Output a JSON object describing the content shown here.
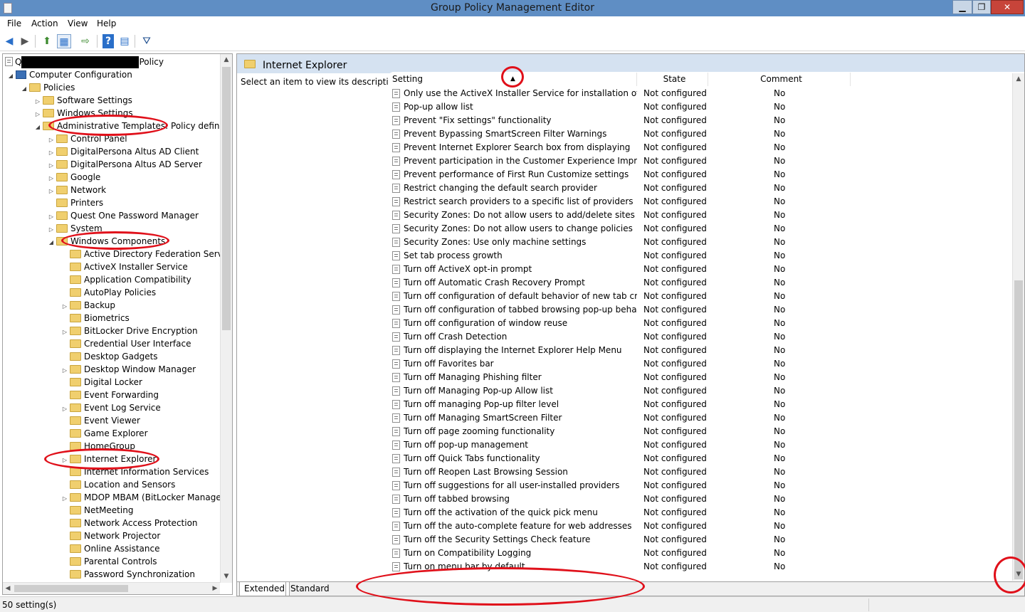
{
  "window": {
    "title": "Group Policy Management Editor"
  },
  "menu": [
    "File",
    "Action",
    "View",
    "Help"
  ],
  "tree": {
    "root_visible": "Q",
    "root_suffix": "Policy",
    "items": [
      {
        "label": "Computer Configuration",
        "level": 1,
        "arrow": "expanded",
        "icon": "computer-icon"
      },
      {
        "label": "Policies",
        "level": 2,
        "arrow": "expanded",
        "icon": "folder-icon"
      },
      {
        "label": "Software Settings",
        "level": 3,
        "arrow": "collapsed",
        "icon": "folder-icon"
      },
      {
        "label": "Windows Settings",
        "level": 3,
        "arrow": "collapsed",
        "icon": "folder-icon"
      },
      {
        "label": "Administrative Templates: Policy definition",
        "level": 3,
        "arrow": "expanded",
        "icon": "folder-icon"
      },
      {
        "label": "Control Panel",
        "level": 4,
        "arrow": "collapsed",
        "icon": "folder-icon"
      },
      {
        "label": "DigitalPersona Altus AD Client",
        "level": 4,
        "arrow": "collapsed",
        "icon": "folder-icon"
      },
      {
        "label": "DigitalPersona Altus AD Server",
        "level": 4,
        "arrow": "collapsed",
        "icon": "folder-icon"
      },
      {
        "label": "Google",
        "level": 4,
        "arrow": "collapsed",
        "icon": "folder-icon"
      },
      {
        "label": "Network",
        "level": 4,
        "arrow": "collapsed",
        "icon": "folder-icon"
      },
      {
        "label": "Printers",
        "level": 4,
        "arrow": "none",
        "icon": "folder-icon"
      },
      {
        "label": "Quest One Password Manager",
        "level": 4,
        "arrow": "collapsed",
        "icon": "folder-icon"
      },
      {
        "label": "System",
        "level": 4,
        "arrow": "collapsed",
        "icon": "folder-icon"
      },
      {
        "label": "Windows Components",
        "level": 4,
        "arrow": "expanded",
        "icon": "folder-icon"
      },
      {
        "label": "Active Directory Federation Services",
        "level": 5,
        "arrow": "none",
        "icon": "folder-icon"
      },
      {
        "label": "ActiveX Installer Service",
        "level": 5,
        "arrow": "none",
        "icon": "folder-icon"
      },
      {
        "label": "Application Compatibility",
        "level": 5,
        "arrow": "none",
        "icon": "folder-icon"
      },
      {
        "label": "AutoPlay Policies",
        "level": 5,
        "arrow": "none",
        "icon": "folder-icon"
      },
      {
        "label": "Backup",
        "level": 5,
        "arrow": "collapsed",
        "icon": "folder-icon"
      },
      {
        "label": "Biometrics",
        "level": 5,
        "arrow": "none",
        "icon": "folder-icon"
      },
      {
        "label": "BitLocker Drive Encryption",
        "level": 5,
        "arrow": "collapsed",
        "icon": "folder-icon"
      },
      {
        "label": "Credential User Interface",
        "level": 5,
        "arrow": "none",
        "icon": "folder-icon"
      },
      {
        "label": "Desktop Gadgets",
        "level": 5,
        "arrow": "none",
        "icon": "folder-icon"
      },
      {
        "label": "Desktop Window Manager",
        "level": 5,
        "arrow": "collapsed",
        "icon": "folder-icon"
      },
      {
        "label": "Digital Locker",
        "level": 5,
        "arrow": "none",
        "icon": "folder-icon"
      },
      {
        "label": "Event Forwarding",
        "level": 5,
        "arrow": "none",
        "icon": "folder-icon"
      },
      {
        "label": "Event Log Service",
        "level": 5,
        "arrow": "collapsed",
        "icon": "folder-icon"
      },
      {
        "label": "Event Viewer",
        "level": 5,
        "arrow": "none",
        "icon": "folder-icon"
      },
      {
        "label": "Game Explorer",
        "level": 5,
        "arrow": "none",
        "icon": "folder-icon"
      },
      {
        "label": "HomeGroup",
        "level": 5,
        "arrow": "none",
        "icon": "folder-icon"
      },
      {
        "label": "Internet Explorer",
        "level": 5,
        "arrow": "collapsed",
        "icon": "folder-icon",
        "selected": true
      },
      {
        "label": "Internet Information Services",
        "level": 5,
        "arrow": "none",
        "icon": "folder-icon"
      },
      {
        "label": "Location and Sensors",
        "level": 5,
        "arrow": "none",
        "icon": "folder-icon"
      },
      {
        "label": "MDOP MBAM (BitLocker Managem",
        "level": 5,
        "arrow": "collapsed",
        "icon": "folder-icon"
      },
      {
        "label": "NetMeeting",
        "level": 5,
        "arrow": "none",
        "icon": "folder-icon"
      },
      {
        "label": "Network Access Protection",
        "level": 5,
        "arrow": "none",
        "icon": "folder-icon"
      },
      {
        "label": "Network Projector",
        "level": 5,
        "arrow": "none",
        "icon": "folder-icon"
      },
      {
        "label": "Online Assistance",
        "level": 5,
        "arrow": "none",
        "icon": "folder-icon"
      },
      {
        "label": "Parental Controls",
        "level": 5,
        "arrow": "none",
        "icon": "folder-icon"
      },
      {
        "label": "Password Synchronization",
        "level": 5,
        "arrow": "none",
        "icon": "folder-icon"
      }
    ]
  },
  "details": {
    "heading": "Internet Explorer",
    "description": "Select an item to view its description.",
    "columns": [
      "Setting",
      "State",
      "Comment"
    ],
    "sort_indicator": "▲",
    "rows": [
      {
        "setting": "Only use the ActiveX Installer Service for installation of Activ...",
        "state": "Not configured",
        "comment": "No"
      },
      {
        "setting": "Pop-up allow list",
        "state": "Not configured",
        "comment": "No"
      },
      {
        "setting": "Prevent \"Fix settings\" functionality",
        "state": "Not configured",
        "comment": "No"
      },
      {
        "setting": "Prevent Bypassing SmartScreen Filter Warnings",
        "state": "Not configured",
        "comment": "No"
      },
      {
        "setting": "Prevent Internet Explorer Search box from displaying",
        "state": "Not configured",
        "comment": "No"
      },
      {
        "setting": "Prevent participation in the Customer Experience Improvem...",
        "state": "Not configured",
        "comment": "No"
      },
      {
        "setting": "Prevent performance of First Run Customize settings",
        "state": "Not configured",
        "comment": "No"
      },
      {
        "setting": "Restrict changing the default search provider",
        "state": "Not configured",
        "comment": "No"
      },
      {
        "setting": "Restrict search providers to a specific list of providers",
        "state": "Not configured",
        "comment": "No"
      },
      {
        "setting": "Security Zones: Do not allow users to add/delete sites",
        "state": "Not configured",
        "comment": "No"
      },
      {
        "setting": "Security Zones: Do not allow users to change policies",
        "state": "Not configured",
        "comment": "No"
      },
      {
        "setting": "Security Zones: Use only machine settings",
        "state": "Not configured",
        "comment": "No"
      },
      {
        "setting": "Set tab process growth",
        "state": "Not configured",
        "comment": "No"
      },
      {
        "setting": "Turn off ActiveX opt-in prompt",
        "state": "Not configured",
        "comment": "No"
      },
      {
        "setting": "Turn off Automatic Crash Recovery Prompt",
        "state": "Not configured",
        "comment": "No"
      },
      {
        "setting": "Turn off configuration of default behavior of new tab creation",
        "state": "Not configured",
        "comment": "No"
      },
      {
        "setting": "Turn off configuration of tabbed browsing pop-up behavior",
        "state": "Not configured",
        "comment": "No"
      },
      {
        "setting": "Turn off configuration of window reuse",
        "state": "Not configured",
        "comment": "No"
      },
      {
        "setting": "Turn off Crash Detection",
        "state": "Not configured",
        "comment": "No"
      },
      {
        "setting": "Turn off displaying the Internet Explorer Help Menu",
        "state": "Not configured",
        "comment": "No"
      },
      {
        "setting": "Turn off Favorites bar",
        "state": "Not configured",
        "comment": "No"
      },
      {
        "setting": "Turn off Managing Phishing filter",
        "state": "Not configured",
        "comment": "No"
      },
      {
        "setting": "Turn off Managing Pop-up Allow list",
        "state": "Not configured",
        "comment": "No"
      },
      {
        "setting": "Turn off managing Pop-up filter level",
        "state": "Not configured",
        "comment": "No"
      },
      {
        "setting": "Turn off Managing SmartScreen Filter",
        "state": "Not configured",
        "comment": "No"
      },
      {
        "setting": "Turn off page zooming functionality",
        "state": "Not configured",
        "comment": "No"
      },
      {
        "setting": "Turn off pop-up management",
        "state": "Not configured",
        "comment": "No"
      },
      {
        "setting": "Turn off Quick Tabs functionality",
        "state": "Not configured",
        "comment": "No"
      },
      {
        "setting": "Turn off Reopen Last Browsing Session",
        "state": "Not configured",
        "comment": "No"
      },
      {
        "setting": "Turn off suggestions for all user-installed providers",
        "state": "Not configured",
        "comment": "No"
      },
      {
        "setting": "Turn off tabbed browsing",
        "state": "Not configured",
        "comment": "No"
      },
      {
        "setting": "Turn off the activation of the quick pick menu",
        "state": "Not configured",
        "comment": "No"
      },
      {
        "setting": "Turn off the auto-complete feature for web addresses",
        "state": "Not configured",
        "comment": "No"
      },
      {
        "setting": "Turn off the Security Settings Check feature",
        "state": "Not configured",
        "comment": "No"
      },
      {
        "setting": "Turn on Compatibility Logging",
        "state": "Not configured",
        "comment": "No"
      },
      {
        "setting": "Turn on menu bar by default",
        "state": "Not configured",
        "comment": "No"
      }
    ]
  },
  "tabs": [
    "Extended",
    "Standard"
  ],
  "status": "50 setting(s)",
  "annotation_color": "#e0101a"
}
